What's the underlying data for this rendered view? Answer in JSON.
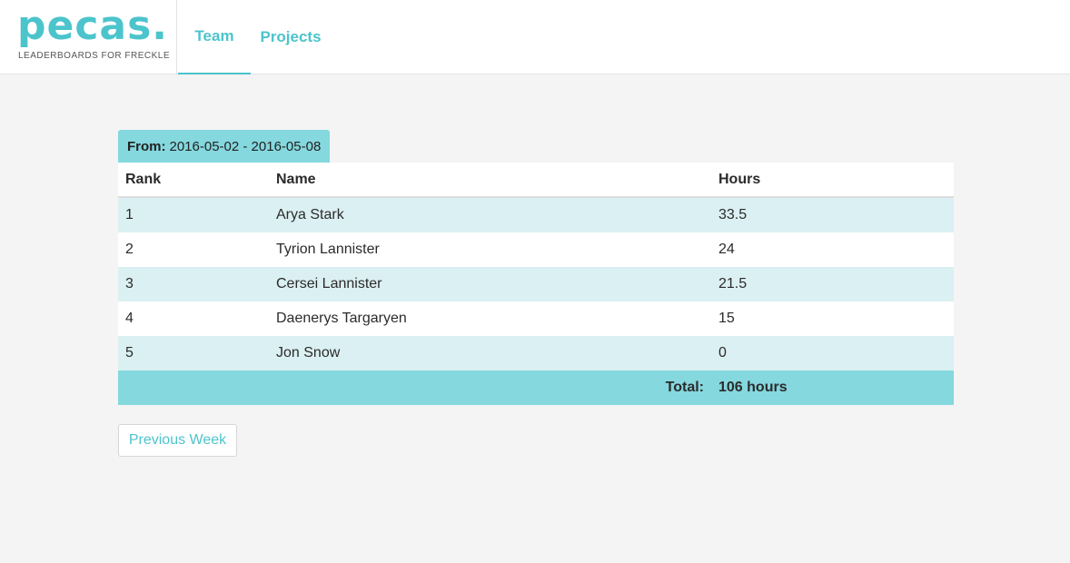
{
  "brand": {
    "logo": "pecas.",
    "tagline": "LEADERBOARDS FOR FRECKLE"
  },
  "nav": {
    "tabs": [
      {
        "label": "Team",
        "active": true
      },
      {
        "label": "Projects",
        "active": false
      }
    ]
  },
  "range": {
    "label": "From:",
    "value": "2016-05-02 - 2016-05-08"
  },
  "table": {
    "headers": [
      "Rank",
      "Name",
      "Hours"
    ],
    "rows": [
      [
        "1",
        "Arya Stark",
        "33.5"
      ],
      [
        "2",
        "Tyrion Lannister",
        "24"
      ],
      [
        "3",
        "Cersei Lannister",
        "21.5"
      ],
      [
        "4",
        "Daenerys Targaryen",
        "15"
      ],
      [
        "5",
        "Jon Snow",
        "0"
      ]
    ],
    "total_label": "Total:",
    "total_value": "106 hours"
  },
  "actions": {
    "previous_week": "Previous Week"
  },
  "colors": {
    "accent": "#4cc4cc",
    "badge": "#84d8de",
    "row_alt": "#dbf0f2"
  }
}
